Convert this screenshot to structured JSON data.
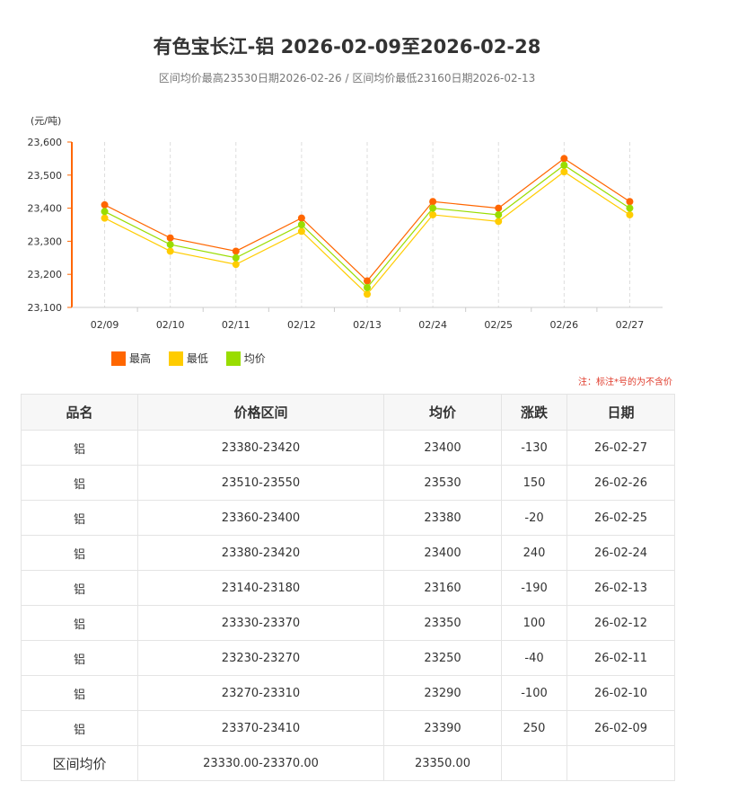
{
  "title": "有色宝长江-铝 2026-02-09至2026-02-28",
  "subtitle": "区间均价最高23530日期2026-02-26 / 区间均价最低23160日期2026-02-13",
  "note": "注：标注*号的为不含价",
  "colors": {
    "high": "#ff6600",
    "low": "#ffcc00",
    "avg": "#99dd00",
    "axis_accent": "#ff6600"
  },
  "chart_data": {
    "type": "line",
    "ylabel": "(元/吨)",
    "ylim": [
      23100,
      23600
    ],
    "yticks": [
      "23,100",
      "23,200",
      "23,300",
      "23,400",
      "23,500",
      "23,600"
    ],
    "categories": [
      "02/09",
      "02/10",
      "02/11",
      "02/12",
      "02/13",
      "02/24",
      "02/25",
      "02/26",
      "02/27"
    ],
    "series": [
      {
        "name": "最高",
        "values": [
          23410,
          23310,
          23270,
          23370,
          23180,
          23420,
          23400,
          23550,
          23420
        ]
      },
      {
        "name": "最低",
        "values": [
          23370,
          23270,
          23230,
          23330,
          23140,
          23380,
          23360,
          23510,
          23380
        ]
      },
      {
        "name": "均价",
        "values": [
          23390,
          23290,
          23250,
          23350,
          23160,
          23400,
          23380,
          23530,
          23400
        ]
      }
    ],
    "grid": "vertical-dashed",
    "legend": "bottom-left"
  },
  "table": {
    "headers": [
      "品名",
      "价格区间",
      "均价",
      "涨跌",
      "日期"
    ],
    "rows": [
      [
        "铝",
        "23380-23420",
        "23400",
        "-130",
        "26-02-27"
      ],
      [
        "铝",
        "23510-23550",
        "23530",
        "150",
        "26-02-26"
      ],
      [
        "铝",
        "23360-23400",
        "23380",
        "-20",
        "26-02-25"
      ],
      [
        "铝",
        "23380-23420",
        "23400",
        "240",
        "26-02-24"
      ],
      [
        "铝",
        "23140-23180",
        "23160",
        "-190",
        "26-02-13"
      ],
      [
        "铝",
        "23330-23370",
        "23350",
        "100",
        "26-02-12"
      ],
      [
        "铝",
        "23230-23270",
        "23250",
        "-40",
        "26-02-11"
      ],
      [
        "铝",
        "23270-23310",
        "23290",
        "-100",
        "26-02-10"
      ],
      [
        "铝",
        "23370-23410",
        "23390",
        "250",
        "26-02-09"
      ]
    ],
    "summary": [
      "区间均价",
      "23330.00-23370.00",
      "23350.00",
      "",
      ""
    ]
  }
}
